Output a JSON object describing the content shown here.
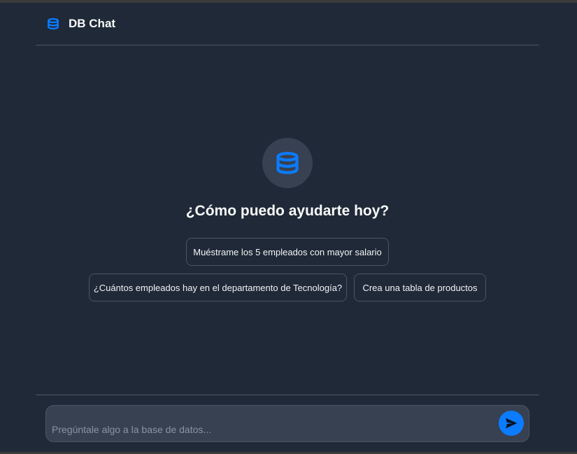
{
  "header": {
    "title": "DB Chat",
    "icon": "database-icon"
  },
  "hero": {
    "icon": "database-icon",
    "title": "¿Cómo puedo ayudarte hoy?"
  },
  "suggestions": [
    {
      "label": "Muéstrame los 5 empleados con mayor salario"
    },
    {
      "label": "¿Cuántos empleados hay en el departamento de Tecnología?"
    },
    {
      "label": "Crea una tabla de productos"
    }
  ],
  "composer": {
    "placeholder": "Pregúntale algo a la base de datos...",
    "value": "",
    "send_icon": "send-icon"
  },
  "colors": {
    "background": "#1f2937",
    "surface": "#374151",
    "border": "#4b5563",
    "accent": "#0b7bff",
    "text": "#f3f4f6"
  }
}
